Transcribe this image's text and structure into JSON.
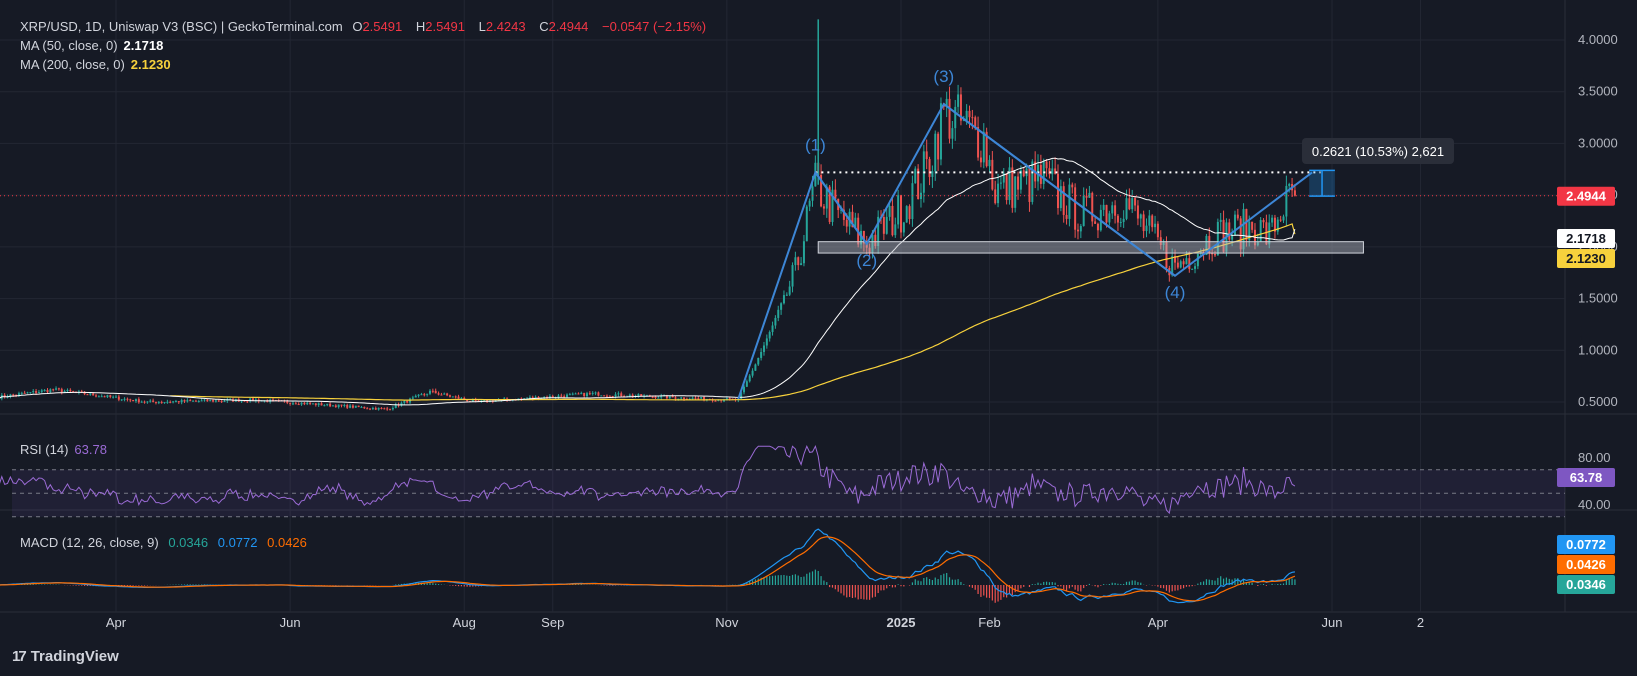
{
  "header": {
    "symbol": "XRP/USD, 1D, Uniswap V3 (BSC) | GeckoTerminal.com",
    "o_label": "O",
    "o_value": "2.5491",
    "h_label": "H",
    "h_value": "2.5491",
    "l_label": "L",
    "l_value": "2.4243",
    "c_label": "C",
    "c_value": "2.4944",
    "change": "−0.0547 (−2.15%)"
  },
  "ma50": {
    "label": "MA (50, close, 0)",
    "value": "2.1718",
    "color": "#ffffff"
  },
  "ma200": {
    "label": "MA (200, close, 0)",
    "value": "2.1230",
    "color": "#f7d13c"
  },
  "rsi": {
    "label": "RSI (14)",
    "value": "63.78",
    "color": "#9b6bd6",
    "ticks": [
      "80.00",
      "40.00"
    ],
    "badge": "63.78"
  },
  "macd": {
    "label": "MACD (12, 26, close, 9)",
    "macd_value": "0.0346",
    "signal_value": "0.0772",
    "hist_value": "0.0426",
    "badges": [
      "0.0772",
      "0.0426",
      "0.0346"
    ],
    "colors": {
      "macd": "#2196f3",
      "signal": "#ff6d00",
      "hist_pos": "#26a69a",
      "hist_neg": "#ef5350"
    }
  },
  "colors": {
    "up": "#26a69a",
    "down": "#ef5350",
    "wave": "#3d86d6",
    "bg": "#161a25",
    "grid": "#232733",
    "price_line": "#f23645"
  },
  "price_badges": {
    "last": "2.4944",
    "ma50": "2.1718",
    "ma200": "2.1230"
  },
  "measure_label": "0.2621 (10.53%) 2,621",
  "wave_labels": [
    "(1)",
    "(2)",
    "(3)",
    "(4)"
  ],
  "watermark": "TradingView",
  "chart_data": {
    "type": "candlestick",
    "title": "XRP/USD, 1D, Uniswap V3 (BSC) | GeckoTerminal.com",
    "x_ticks": [
      "Apr",
      "Jun",
      "Aug",
      "Sep",
      "Nov",
      "2025",
      "Feb",
      "Apr",
      "Jun",
      "2"
    ],
    "y_ticks": [
      "4.0000",
      "3.5000",
      "3.0000",
      "2.5000",
      "2.0000",
      "1.5000",
      "1.0000",
      "0.5000"
    ],
    "ylim": [
      0.45,
      4.2
    ],
    "series": [
      {
        "name": "MA (50, close, 0)",
        "last": 2.1718
      },
      {
        "name": "MA (200, close, 0)",
        "last": 2.123
      }
    ],
    "wave_points": [
      {
        "label": "(1)",
        "date": "2024-12-02",
        "price": 2.72
      },
      {
        "label": "(2)",
        "date": "2024-12-20",
        "price": 2.03
      },
      {
        "label": "(3)",
        "date": "2025-01-16",
        "price": 3.38
      },
      {
        "label": "(4)",
        "date": "2025-04-07",
        "price": 1.72
      }
    ],
    "support_zone": [
      1.94,
      2.05
    ],
    "resistance_level": 2.72,
    "last_close": 2.4944,
    "grid": true
  }
}
